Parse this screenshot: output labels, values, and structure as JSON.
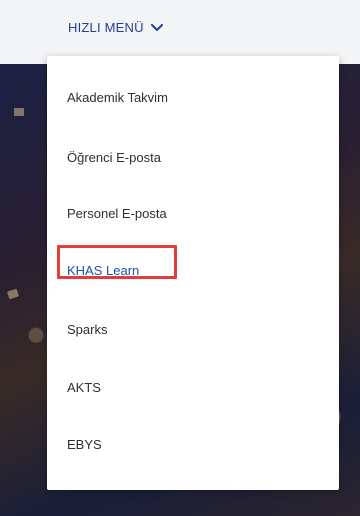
{
  "header": {
    "quick_menu_label": "HIZLI MENÜ"
  },
  "menu": {
    "items": [
      {
        "label": "Akademik Takvim"
      },
      {
        "label": "Öğrenci E-posta"
      },
      {
        "label": "Personel E-posta"
      },
      {
        "label": "KHAS Learn"
      },
      {
        "label": "Sparks"
      },
      {
        "label": "AKTS"
      },
      {
        "label": "EBYS"
      }
    ]
  },
  "colors": {
    "accent_blue": "#1f3f9a",
    "link_blue": "#1f4fb0",
    "highlight_red": "#e53b3b"
  },
  "icons": {
    "quick_menu_chevron": "chevron-down-icon"
  }
}
